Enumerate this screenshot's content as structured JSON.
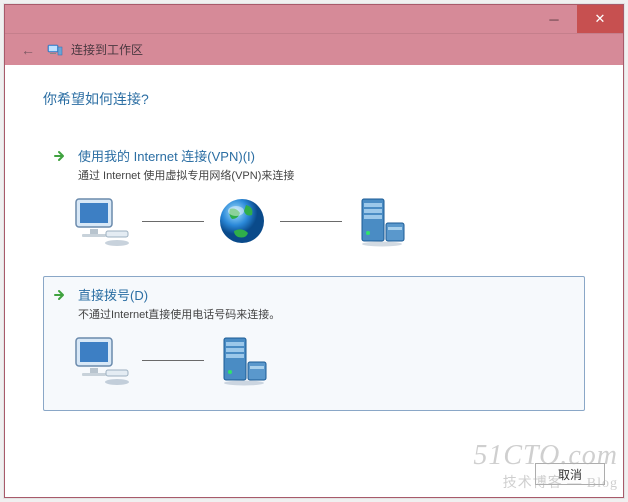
{
  "titlebar": {
    "back_label": "←",
    "title": "连接到工作区",
    "minimize": "─",
    "close": "✕"
  },
  "heading": "你希望如何连接?",
  "options": [
    {
      "title": "使用我的 Internet 连接(VPN)(I)",
      "desc": "通过 Internet 使用虚拟专用网络(VPN)来连接"
    },
    {
      "title": "直接拨号(D)",
      "desc": "不通过Internet直接使用电话号码来连接。"
    }
  ],
  "footer": {
    "cancel": "取消"
  },
  "watermark": {
    "line1": "51CTO.com",
    "line2": "技术博客 — Blog"
  }
}
